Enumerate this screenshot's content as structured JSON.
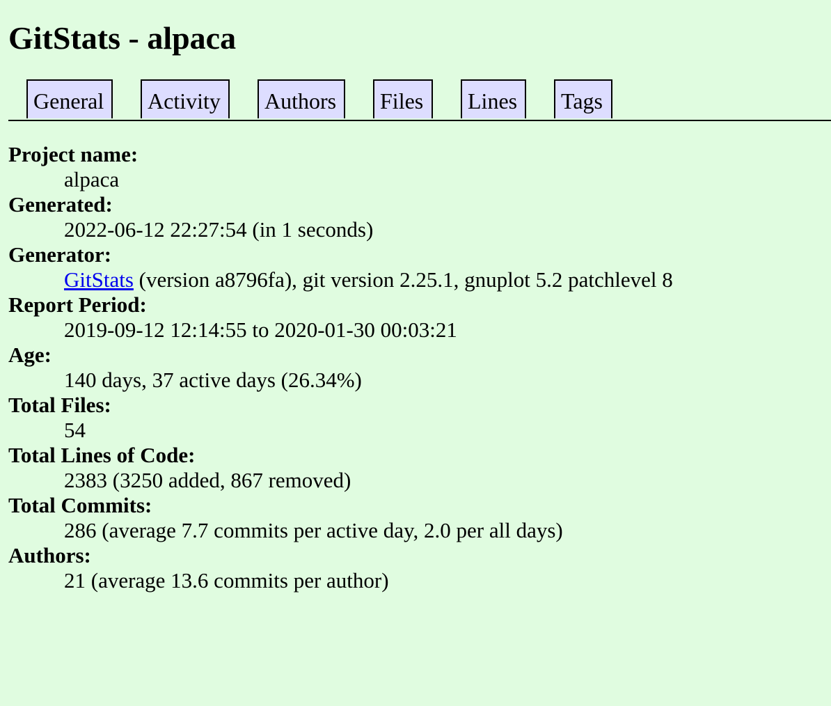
{
  "page": {
    "title": "GitStats - alpaca"
  },
  "nav": {
    "items": [
      {
        "label": "General"
      },
      {
        "label": "Activity"
      },
      {
        "label": "Authors"
      },
      {
        "label": "Files"
      },
      {
        "label": "Lines"
      },
      {
        "label": "Tags"
      }
    ]
  },
  "stats": {
    "project_name": {
      "label": "Project name:",
      "value": "alpaca"
    },
    "generated": {
      "label": "Generated:",
      "value": "2022-06-12 22:27:54 (in 1 seconds)"
    },
    "generator": {
      "label": "Generator:",
      "link_text": "GitStats",
      "rest": " (version a8796fa), git version 2.25.1, gnuplot 5.2 patchlevel 8"
    },
    "report_period": {
      "label": "Report Period:",
      "value": "2019-09-12 12:14:55 to 2020-01-30 00:03:21"
    },
    "age": {
      "label": "Age:",
      "value": "140 days, 37 active days (26.34%)"
    },
    "total_files": {
      "label": "Total Files:",
      "value": "54"
    },
    "total_lines": {
      "label": "Total Lines of Code:",
      "value": "2383 (3250 added, 867 removed)"
    },
    "total_commits": {
      "label": "Total Commits:",
      "value": "286 (average 7.7 commits per active day, 2.0 per all days)"
    },
    "authors": {
      "label": "Authors:",
      "value": "21 (average 13.6 commits per author)"
    }
  },
  "colors": {
    "background": "#e0fce0",
    "tab_background": "#ddddff",
    "link": "#0000ee"
  }
}
